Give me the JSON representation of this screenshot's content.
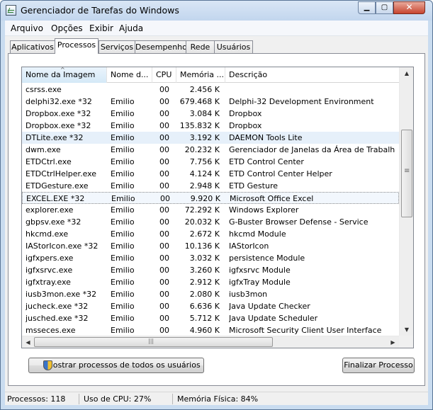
{
  "window": {
    "title": "Gerenciador de Tarefas do Windows"
  },
  "menu": [
    "Arquivo",
    "Opções",
    "Exibir",
    "Ajuda"
  ],
  "tabs": [
    "Aplicativos",
    "Processos",
    "Serviços",
    "Desempenho",
    "Rede",
    "Usuários"
  ],
  "active_tab": "Processos",
  "table": {
    "columns": [
      "Nome da Imagem",
      "Nome d...",
      "CPU",
      "Memória ...",
      "Descrição"
    ],
    "sorted_column": "Nome da Imagem",
    "rows": [
      {
        "name": "csrss.exe",
        "user": "",
        "cpu": "00",
        "mem": "2.456 K",
        "desc": ""
      },
      {
        "name": "delphi32.exe *32",
        "user": "Emilio",
        "cpu": "00",
        "mem": "679.468 K",
        "desc": "Delphi-32 Development Environment"
      },
      {
        "name": "Dropbox.exe *32",
        "user": "Emilio",
        "cpu": "00",
        "mem": "3.084 K",
        "desc": "Dropbox"
      },
      {
        "name": "Dropbox.exe *32",
        "user": "Emilio",
        "cpu": "00",
        "mem": "135.832 K",
        "desc": "Dropbox"
      },
      {
        "name": "DTLite.exe *32",
        "user": "Emilio",
        "cpu": "00",
        "mem": "3.192 K",
        "desc": "DAEMON Tools Lite"
      },
      {
        "name": "dwm.exe",
        "user": "Emilio",
        "cpu": "00",
        "mem": "20.232 K",
        "desc": "Gerenciador de Janelas da Área de Trabalho"
      },
      {
        "name": "ETDCtrl.exe",
        "user": "Emilio",
        "cpu": "00",
        "mem": "7.756 K",
        "desc": "ETD Control Center"
      },
      {
        "name": "ETDCtrlHelper.exe",
        "user": "Emilio",
        "cpu": "00",
        "mem": "4.124 K",
        "desc": "ETD Control Center Helper"
      },
      {
        "name": "ETDGesture.exe",
        "user": "Emilio",
        "cpu": "00",
        "mem": "2.948 K",
        "desc": "ETD Gesture"
      },
      {
        "name": "EXCEL.EXE *32",
        "user": "Emilio",
        "cpu": "00",
        "mem": "9.920 K",
        "desc": "Microsoft Office Excel"
      },
      {
        "name": "explorer.exe",
        "user": "Emilio",
        "cpu": "00",
        "mem": "72.292 K",
        "desc": "Windows Explorer"
      },
      {
        "name": "gbpsv.exe *32",
        "user": "Emilio",
        "cpu": "00",
        "mem": "20.032 K",
        "desc": "G-Buster Browser Defense - Service"
      },
      {
        "name": "hkcmd.exe",
        "user": "Emilio",
        "cpu": "00",
        "mem": "2.672 K",
        "desc": "hkcmd Module"
      },
      {
        "name": "IAStorIcon.exe *32",
        "user": "Emilio",
        "cpu": "00",
        "mem": "10.136 K",
        "desc": "IAStorIcon"
      },
      {
        "name": "igfxpers.exe",
        "user": "Emilio",
        "cpu": "00",
        "mem": "3.032 K",
        "desc": "persistence Module"
      },
      {
        "name": "igfxsrvc.exe",
        "user": "Emilio",
        "cpu": "00",
        "mem": "3.260 K",
        "desc": "igfxsrvc Module"
      },
      {
        "name": "igfxtray.exe",
        "user": "Emilio",
        "cpu": "00",
        "mem": "2.912 K",
        "desc": "igfxTray Module"
      },
      {
        "name": "iusb3mon.exe *32",
        "user": "Emilio",
        "cpu": "00",
        "mem": "2.080 K",
        "desc": "iusb3mon"
      },
      {
        "name": "jucheck.exe *32",
        "user": "Emilio",
        "cpu": "00",
        "mem": "6.636 K",
        "desc": "Java Update Checker"
      },
      {
        "name": "jusched.exe *32",
        "user": "Emilio",
        "cpu": "00",
        "mem": "5.712 K",
        "desc": "Java Update Scheduler"
      },
      {
        "name": "msseces.exe",
        "user": "Emilio",
        "cpu": "00",
        "mem": "4.960 K",
        "desc": "Microsoft Security Client User Interface"
      }
    ],
    "selected_row": 9,
    "hover_row": 4
  },
  "buttons": {
    "show_all": "Mostrar processos de todos os usuários",
    "end_process": "Finalizar Processo"
  },
  "status": {
    "processes": "Processos: 118",
    "cpu": "Uso de CPU: 27%",
    "memory": "Memória Física: 84%"
  },
  "icons": {
    "app": "task-manager-icon",
    "shield": "uac-shield-icon"
  }
}
